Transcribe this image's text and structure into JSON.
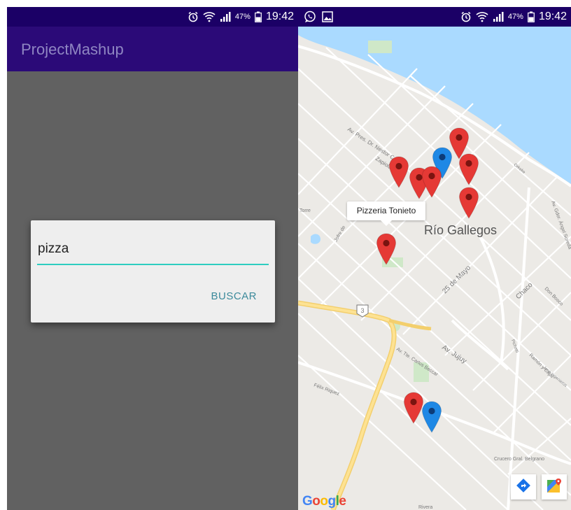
{
  "status_bar": {
    "left_phone": {
      "battery": "47%",
      "time": "19:42"
    },
    "right_phone": {
      "battery": "47%",
      "time": "19:42",
      "icons": [
        "whatsapp-icon",
        "image-icon",
        "alarm-icon",
        "wifi-icon",
        "signal-icon",
        "battery-icon"
      ]
    }
  },
  "app": {
    "title": "ProjectMashup"
  },
  "dialog": {
    "query_value": "pizza",
    "search_button": "BUSCAR"
  },
  "map": {
    "city": "Río Gallegos",
    "selected_place": "Pizzeria Tonieto",
    "street_labels": [
      "Av. Pres. Dr. Nestor C.",
      "Zapiola",
      "25 de Mayo",
      "Chaco",
      "Av. Jujuy",
      "Av. Tte. Carlos Beccar",
      "Félix Riquez",
      "Crucero Gral. Belgrano",
      "Ramón y Cajal",
      "Don Bosco",
      "Av. Gdor. Ángel Sureda",
      "Jofre de",
      "Torre",
      "Pichetti",
      "Orkeke",
      "José Ingenieros",
      "Rivera"
    ],
    "route_shield": "3",
    "attribution": "Google",
    "markers": [
      {
        "color": "red"
      },
      {
        "color": "blue"
      },
      {
        "color": "red"
      },
      {
        "color": "red"
      },
      {
        "color": "red"
      },
      {
        "color": "red"
      },
      {
        "color": "red"
      },
      {
        "color": "red"
      },
      {
        "color": "red"
      },
      {
        "color": "blue"
      }
    ],
    "buttons": [
      "directions-icon",
      "google-maps-icon"
    ]
  },
  "colors": {
    "status_bar": "#1b0066",
    "app_bar": "#2b0a78",
    "accent": "#2ecdc0",
    "water": "#aadaff",
    "marker_red": "#e53935",
    "marker_blue": "#1e88e5"
  }
}
